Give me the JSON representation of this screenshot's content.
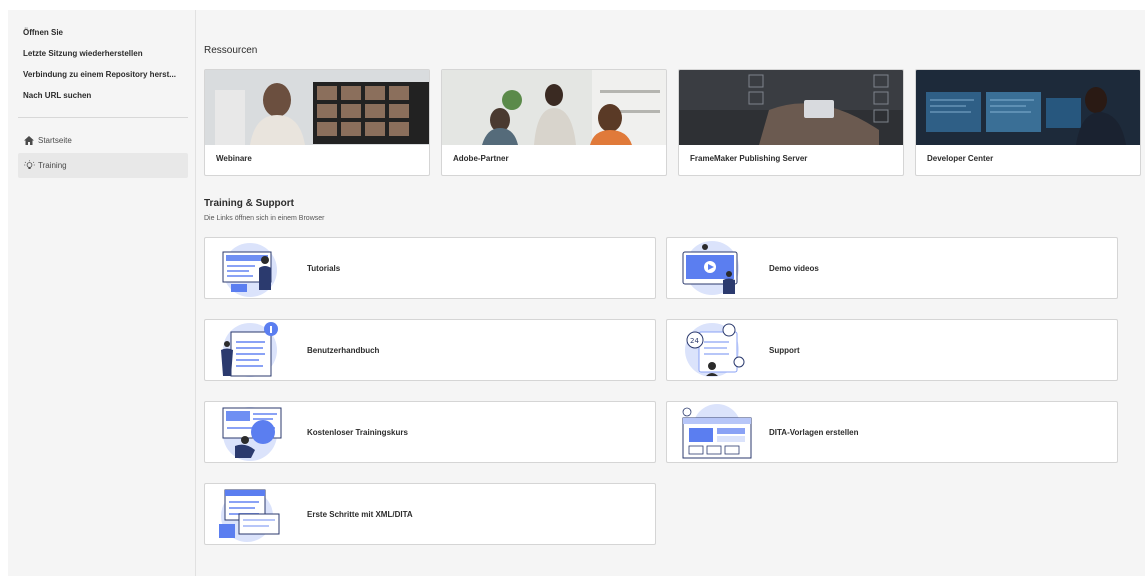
{
  "sidebar": {
    "links": [
      {
        "label": "Öffnen Sie"
      },
      {
        "label": "Letzte Sitzung wiederherstellen"
      },
      {
        "label": "Verbindung zu einem Repository herst..."
      },
      {
        "label": "Nach URL suchen"
      }
    ],
    "nav": [
      {
        "label": "Startseite",
        "icon": "home-icon"
      },
      {
        "label": "Training",
        "icon": "lightbulb-icon",
        "active": true
      }
    ]
  },
  "resources": {
    "title": "Ressourcen",
    "cards": [
      {
        "label": "Webinare"
      },
      {
        "label": "Adobe-Partner"
      },
      {
        "label": "FrameMaker Publishing Server"
      },
      {
        "label": "Developer Center"
      }
    ]
  },
  "training": {
    "title": "Training & Support",
    "subtitle": "Die Links öffnen sich in einem Browser",
    "cards": [
      {
        "label": "Tutorials"
      },
      {
        "label": "Demo videos"
      },
      {
        "label": "Benutzerhandbuch"
      },
      {
        "label": "Support"
      },
      {
        "label": "Kostenloser Trainingskurs"
      },
      {
        "label": "DITA-Vorlagen erstellen"
      },
      {
        "label": "Erste Schritte mit XML/DITA"
      }
    ]
  },
  "colors": {
    "accent_blue": "#5b7ef0",
    "sidebar_active": "#e8e8e8",
    "background": "#f5f5f5"
  }
}
